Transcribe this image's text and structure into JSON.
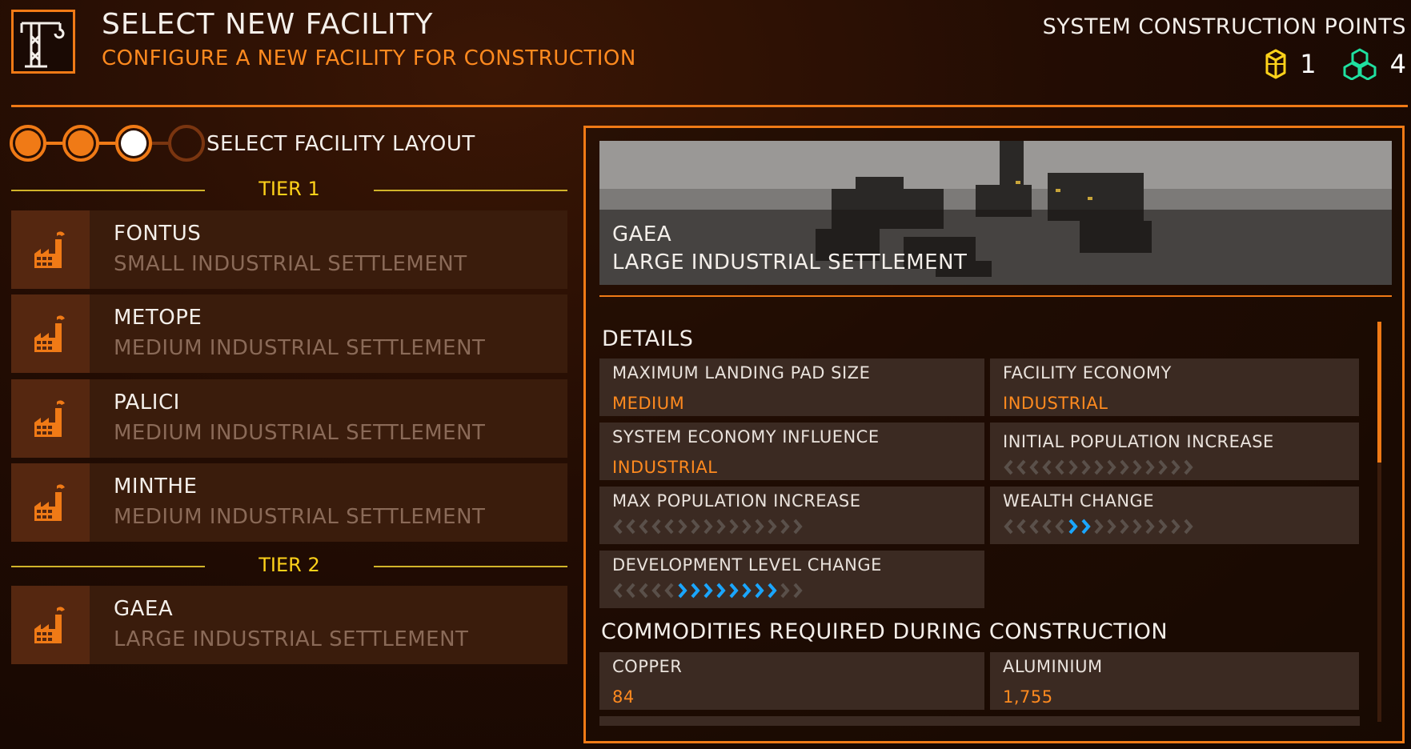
{
  "header": {
    "icon": "construction-crane-icon",
    "title": "SELECT NEW FACILITY",
    "subtitle": "CONFIGURE A NEW FACILITY FOR CONSTRUCTION",
    "points_label": "SYSTEM CONSTRUCTION POINTS",
    "tier2_points": "1",
    "tier3_points": "4",
    "tier2_color": "#ffd21a",
    "tier3_color": "#1fe0a0"
  },
  "steps": {
    "label": "SELECT FACILITY LAYOUT",
    "total": 4,
    "current": 3
  },
  "tiers": [
    {
      "label": "TIER 1",
      "facilities": [
        {
          "name": "FONTUS",
          "type": "SMALL INDUSTRIAL SETTLEMENT"
        },
        {
          "name": "METOPE",
          "type": "MEDIUM INDUSTRIAL SETTLEMENT"
        },
        {
          "name": "PALICI",
          "type": "MEDIUM INDUSTRIAL SETTLEMENT"
        },
        {
          "name": "MINTHE",
          "type": "MEDIUM INDUSTRIAL SETTLEMENT"
        }
      ]
    },
    {
      "label": "TIER 2",
      "facilities": [
        {
          "name": "GAEA",
          "type": "LARGE INDUSTRIAL SETTLEMENT"
        }
      ]
    }
  ],
  "selected": {
    "name": "GAEA",
    "type": "LARGE INDUSTRIAL SETTLEMENT",
    "details_title": "DETAILS",
    "details": {
      "landing_pad": {
        "label": "MAXIMUM LANDING PAD SIZE",
        "value": "MEDIUM"
      },
      "economy": {
        "label": "FACILITY ECONOMY",
        "value": "INDUSTRIAL"
      },
      "influence": {
        "label": "SYSTEM ECONOMY INFLUENCE",
        "value": "INDUSTRIAL"
      },
      "initial_pop": {
        "label": "INITIAL POPULATION INCREASE",
        "level": 0
      },
      "max_pop": {
        "label": "MAX POPULATION INCREASE",
        "level": 0
      },
      "wealth": {
        "label": "WEALTH CHANGE",
        "level": 2
      },
      "development": {
        "label": "DEVELOPMENT LEVEL CHANGE",
        "level": 8
      }
    },
    "commodities_title": "COMMODITIES REQUIRED DURING CONSTRUCTION",
    "commodities": [
      {
        "name": "COPPER",
        "amount": "84"
      },
      {
        "name": "ALUMINIUM",
        "amount": "1,755"
      }
    ]
  }
}
